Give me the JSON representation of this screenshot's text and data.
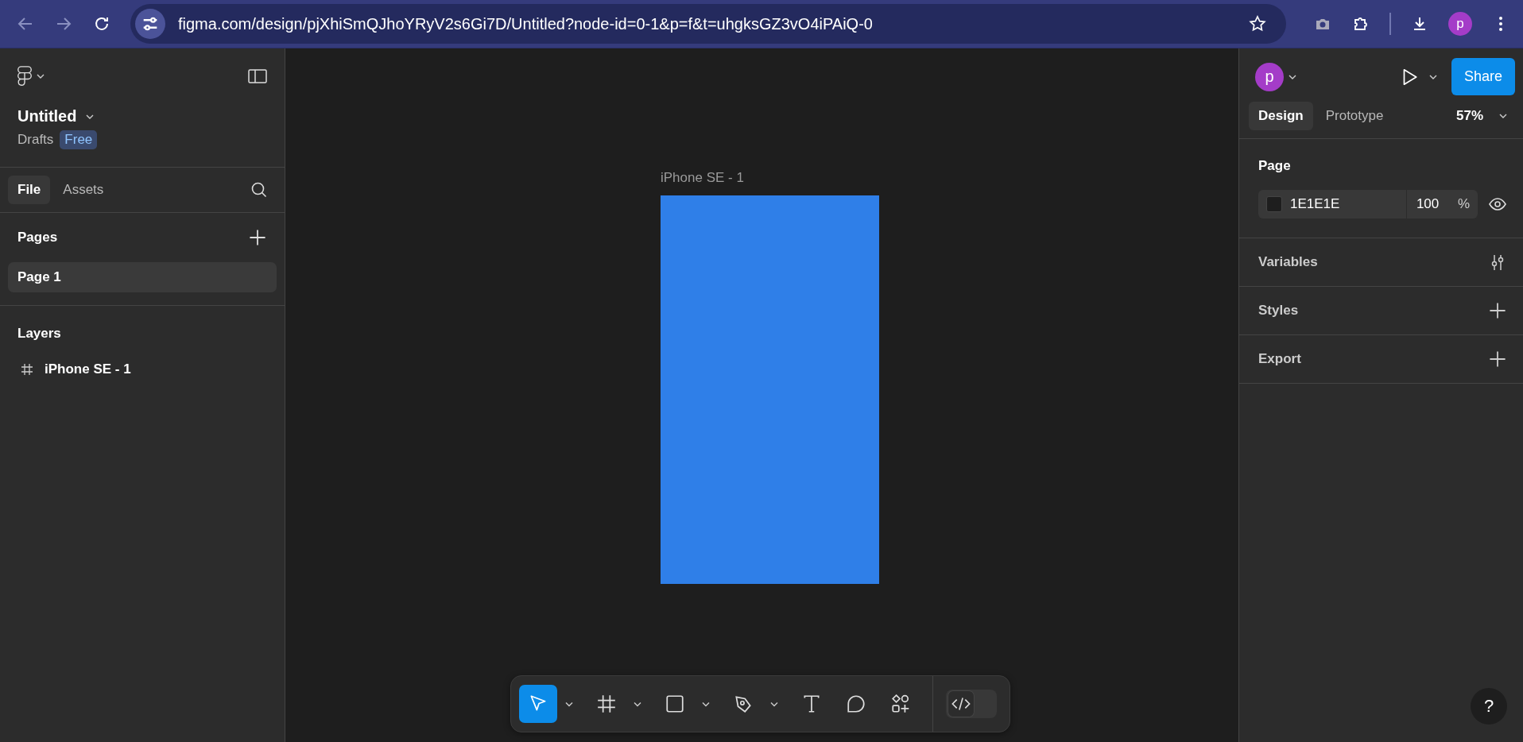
{
  "browser": {
    "url": "figma.com/design/pjXhiSmQJhoYRyV2s6Gi7D/Untitled?node-id=0-1&p=f&t=uhgksGZ3vO4iPAiQ-0",
    "avatar_letter": "p"
  },
  "sidebar": {
    "file_title": "Untitled",
    "location": "Drafts",
    "plan_badge": "Free",
    "tabs": [
      {
        "label": "File",
        "selected": true
      },
      {
        "label": "Assets",
        "selected": false
      }
    ],
    "pages_heading": "Pages",
    "pages": [
      {
        "label": "Page 1",
        "selected": true
      }
    ],
    "layers_heading": "Layers",
    "layers": [
      {
        "name": "iPhone SE - 1"
      }
    ]
  },
  "canvas": {
    "frame_label": "iPhone SE - 1"
  },
  "toolbar": {
    "tools": [
      {
        "kind": "move",
        "selected": true,
        "has_menu": true
      },
      {
        "kind": "frame",
        "selected": false,
        "has_menu": true
      },
      {
        "kind": "rectangle",
        "selected": false,
        "has_menu": true
      },
      {
        "kind": "pen",
        "selected": false,
        "has_menu": true
      },
      {
        "kind": "text",
        "selected": false,
        "has_menu": false
      },
      {
        "kind": "comment",
        "selected": false,
        "has_menu": false
      },
      {
        "kind": "actions",
        "selected": false,
        "has_menu": false
      }
    ],
    "dev_mode": {
      "on": false
    }
  },
  "inspector": {
    "avatar_letter": "p",
    "share_label": "Share",
    "tabs": [
      {
        "label": "Design",
        "selected": true
      },
      {
        "label": "Prototype",
        "selected": false
      }
    ],
    "zoom": "57%",
    "page_heading": "Page",
    "fill_hex": "1E1E1E",
    "opacity": "100",
    "opacity_unit": "%",
    "sections": [
      {
        "label": "Variables",
        "kind": "variables"
      },
      {
        "label": "Styles",
        "kind": "add"
      },
      {
        "label": "Export",
        "kind": "add"
      }
    ]
  },
  "help_label": "?"
}
